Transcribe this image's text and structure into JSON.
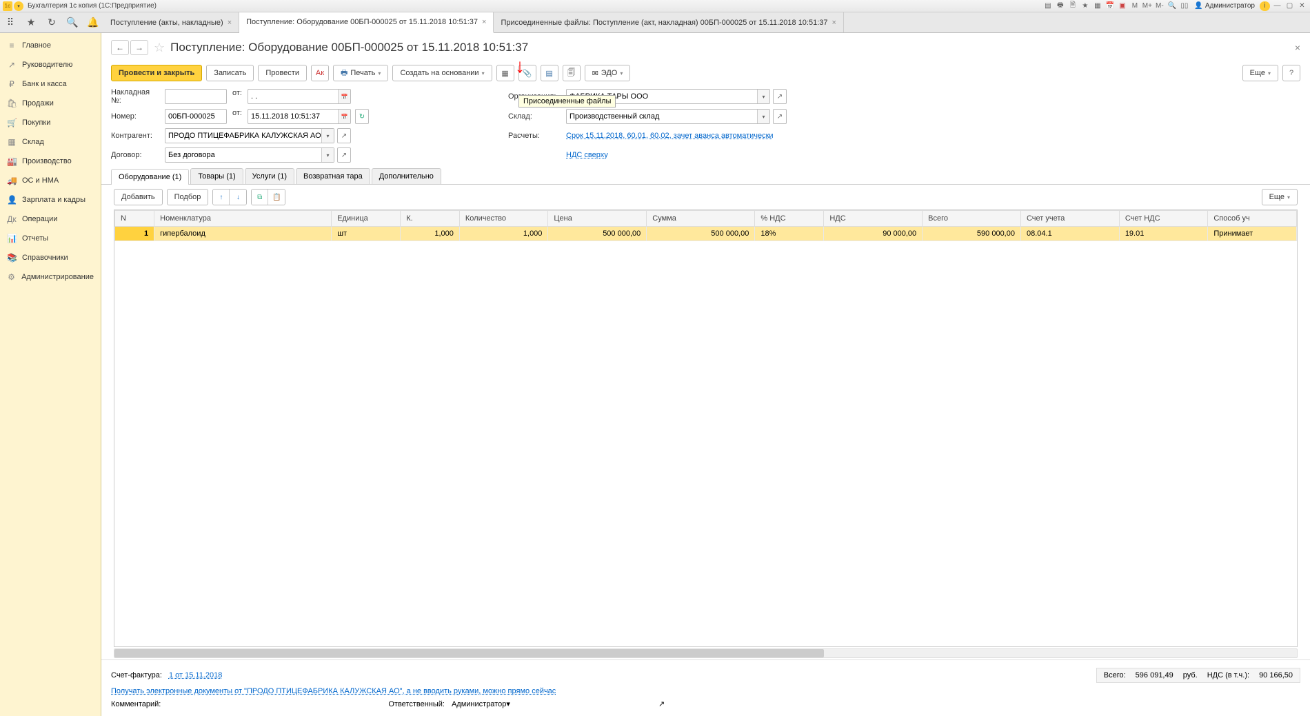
{
  "titlebar": {
    "app_title": "Бухгалтерия 1с копия  (1С:Предприятие)",
    "user": "Администратор",
    "m_labels": [
      "M",
      "M+",
      "M-"
    ]
  },
  "tabs": [
    {
      "label": "Поступление (акты, накладные)"
    },
    {
      "label": "Поступление: Оборудование 00БП-000025 от 15.11.2018 10:51:37",
      "active": true
    },
    {
      "label": "Присоединенные файлы: Поступление (акт, накладная) 00БП-000025 от 15.11.2018 10:51:37"
    }
  ],
  "sidebar": [
    {
      "icon": "≡",
      "label": "Главное"
    },
    {
      "icon": "↗",
      "label": "Руководителю"
    },
    {
      "icon": "₽",
      "label": "Банк и касса"
    },
    {
      "icon": "🛍",
      "label": "Продажи"
    },
    {
      "icon": "🛒",
      "label": "Покупки"
    },
    {
      "icon": "▦",
      "label": "Склад"
    },
    {
      "icon": "🏭",
      "label": "Производство"
    },
    {
      "icon": "🚚",
      "label": "ОС и НМА"
    },
    {
      "icon": "👤",
      "label": "Зарплата и кадры"
    },
    {
      "icon": "Дк",
      "label": "Операции"
    },
    {
      "icon": "📊",
      "label": "Отчеты"
    },
    {
      "icon": "📚",
      "label": "Справочники"
    },
    {
      "icon": "⚙",
      "label": "Администрирование"
    }
  ],
  "page": {
    "title": "Поступление: Оборудование 00БП-000025 от 15.11.2018 10:51:37"
  },
  "cmd": {
    "post_close": "Провести и закрыть",
    "save": "Записать",
    "post": "Провести",
    "print": "Печать",
    "create_based": "Создать на основании",
    "edo": "ЭДО",
    "more": "Еще"
  },
  "tooltip": "Присоединенные файлы",
  "form": {
    "invoice_lbl": "Накладная №:",
    "invoice_val": "",
    "from": "от:",
    "invoice_date": ".  .",
    "org_lbl": "Организация:",
    "org_val": "ФАБРИКА ТАРЫ ООО",
    "num_lbl": "Номер:",
    "num_val": "00БП-000025",
    "date_val": "15.11.2018 10:51:37",
    "wh_lbl": "Склад:",
    "wh_val": "Производственный склад",
    "contr_lbl": "Контрагент:",
    "contr_val": "ПРОДО ПТИЦЕФАБРИКА КАЛУЖСКАЯ АО",
    "calc_lbl": "Расчеты:",
    "calc_link": "Срок 15.11.2018, 60.01, 60.02, зачет аванса автоматически",
    "deal_lbl": "Договор:",
    "deal_val": "Без договора",
    "vat_link": "НДС сверху"
  },
  "dtabs": [
    {
      "label": "Оборудование (1)",
      "active": true
    },
    {
      "label": "Товары (1)"
    },
    {
      "label": "Услуги (1)"
    },
    {
      "label": "Возвратная тара"
    },
    {
      "label": "Дополнительно"
    }
  ],
  "tblbar": {
    "add": "Добавить",
    "select": "Подбор",
    "more": "Еще"
  },
  "columns": [
    "N",
    "Номенклатура",
    "Единица",
    "К.",
    "Количество",
    "Цена",
    "Сумма",
    "% НДС",
    "НДС",
    "Всего",
    "Счет учета",
    "Счет НДС",
    "Способ уч"
  ],
  "rows": [
    {
      "n": "1",
      "nom": "гипербалоид",
      "unit": "шт",
      "k": "1,000",
      "qty": "1,000",
      "price": "500 000,00",
      "sum": "500 000,00",
      "vat_pct": "18%",
      "vat": "90 000,00",
      "total": "590 000,00",
      "acc": "08.04.1",
      "acc_vat": "19.01",
      "method": "Принимает"
    }
  ],
  "footer": {
    "sf_lbl": "Счет-фактура:",
    "sf_link": "1 от 15.11.2018",
    "total_lbl": "Всего:",
    "total_val": "596 091,49",
    "cur": "руб.",
    "vat_incl_lbl": "НДС (в т.ч.):",
    "vat_incl_val": "90 166,50",
    "promo_link": "Получать электронные документы от \"ПРОДО ПТИЦЕФАБРИКА КАЛУЖСКАЯ АО\", а не вводить руками, можно прямо сейчас",
    "comment_lbl": "Комментарий:",
    "comment_val": "",
    "resp_lbl": "Ответственный:",
    "resp_val": "Администратор"
  }
}
